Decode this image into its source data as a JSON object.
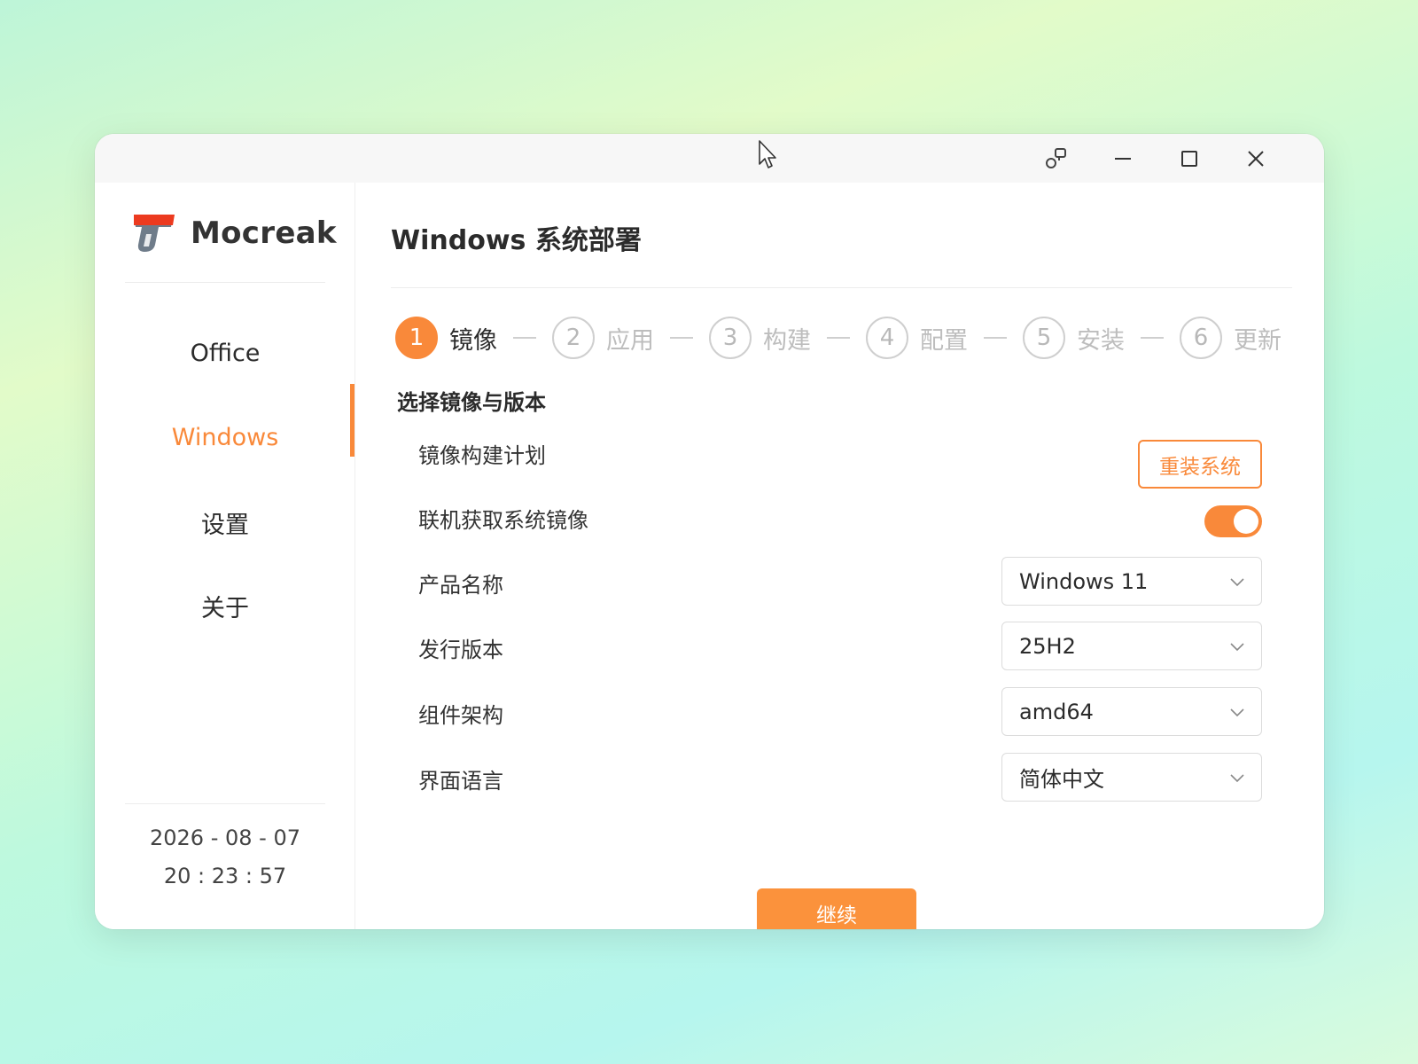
{
  "app": {
    "name": "Mocreak"
  },
  "titlebar": {
    "icons": [
      "restore-layout-icon",
      "minimize-icon",
      "maximize-icon",
      "close-icon"
    ]
  },
  "sidebar": {
    "items": [
      {
        "label": "Office"
      },
      {
        "label": "Windows",
        "active": true
      },
      {
        "label": "设置"
      },
      {
        "label": "关于"
      }
    ],
    "date": "2026 - 08 - 07",
    "time": "20 : 23 : 57"
  },
  "main": {
    "title": "Windows 系统部署",
    "steps": [
      {
        "num": "1",
        "label": "镜像",
        "active": true
      },
      {
        "num": "2",
        "label": "应用"
      },
      {
        "num": "3",
        "label": "构建"
      },
      {
        "num": "4",
        "label": "配置"
      },
      {
        "num": "5",
        "label": "安装"
      },
      {
        "num": "6",
        "label": "更新"
      }
    ],
    "section_title": "选择镜像与版本",
    "build_plan": {
      "label": "镜像构建计划",
      "button": "重装系统"
    },
    "online_image": {
      "label": "联机获取系统镜像",
      "enabled": true
    },
    "product": {
      "label": "产品名称",
      "value": "Windows 11"
    },
    "release": {
      "label": "发行版本",
      "value": "25H2"
    },
    "arch": {
      "label": "组件架构",
      "value": "amd64"
    },
    "language": {
      "label": "界面语言",
      "value": "简体中文"
    },
    "continue_label": "继续"
  },
  "colors": {
    "accent": "#f9893a",
    "logo_red": "#ec3a1f",
    "logo_gray": "#6f7c8a"
  }
}
